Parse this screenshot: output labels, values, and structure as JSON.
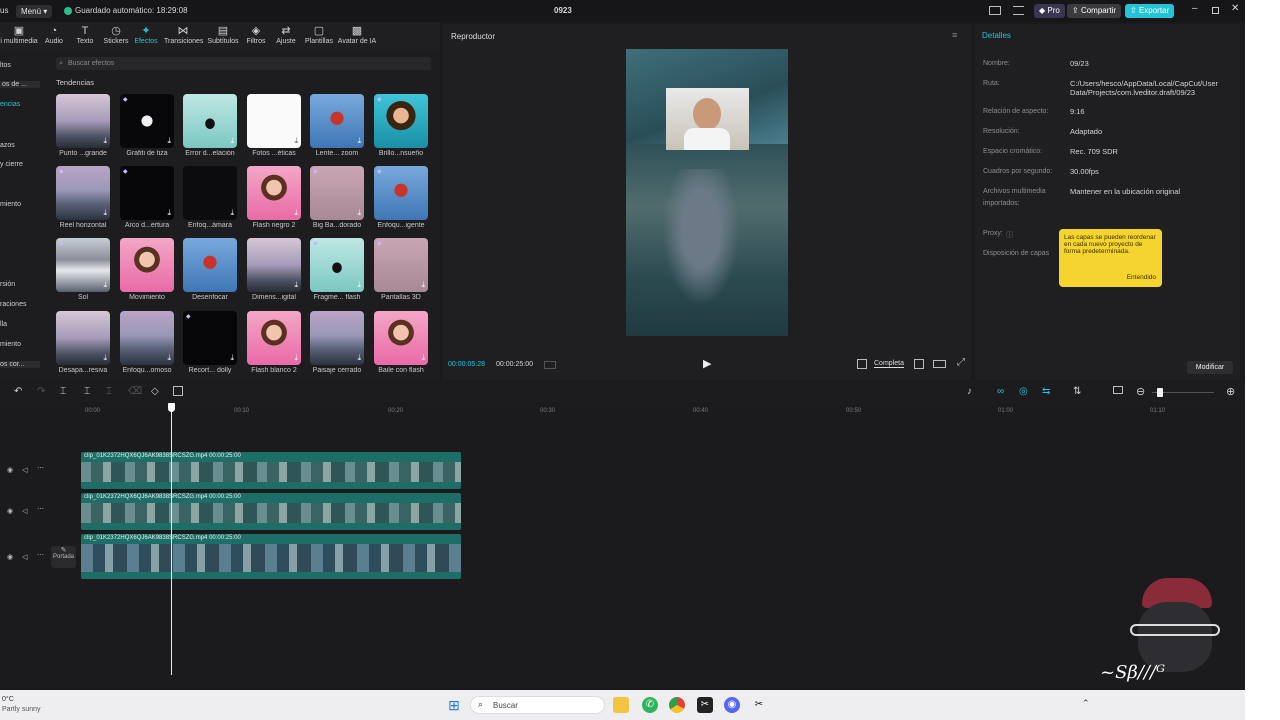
{
  "titlebar": {
    "left_fragment": "us",
    "menu_label": "Menú",
    "autosave": "Guardado automático: 18:29:08",
    "project_name": "0923",
    "pro_label": "Pro",
    "share_label": "Compartir",
    "export_label": "Exportar",
    "accent": "#23c4d8"
  },
  "toolbar": {
    "items": [
      "multimedia",
      "Audio",
      "Texto",
      "Stickers",
      "Efectos",
      "Transiciones",
      "Subtítulos",
      "Filtros",
      "Ajuste",
      "Plantillas",
      "Avatar de IA"
    ],
    "first_label": "i multimedia",
    "active": "Efectos"
  },
  "sidebar": {
    "items": [
      "ltos",
      "os de ...",
      "encias",
      "azos",
      "y cierre",
      "miento",
      "rsión",
      "raciones",
      "lla",
      "miento",
      "os cor..."
    ]
  },
  "effects": {
    "search_placeholder": "Buscar efectos",
    "section_title": "Tendencias",
    "tiles": [
      "Punto ...grande",
      "Grafiti de tiza",
      "Error d...elación",
      "Fotos ...éticas",
      "Lente... zoom",
      "Brillo...nsueño",
      "Reel horizontal",
      "Arco d...ertura",
      "Enfoq...ámara",
      "Flash negro 2",
      "Big Ba...dorado",
      "Enfoqu...igente",
      "Sol",
      "Movimiento",
      "Desenfocar",
      "Dimens...igital",
      "Fragme... flash",
      "Pantallas 3D",
      "Desapa...resiva",
      "Enfoqu...omoso",
      "Recort... dolly",
      "Flash blanco 2",
      "Paisaje cerrado",
      "Baile con flash"
    ]
  },
  "player": {
    "title": "Reproductor",
    "current_time": "00:00:05:28",
    "total_time": "00:00:25:00",
    "ratio_label": "Completa"
  },
  "details": {
    "title": "Detalles",
    "labels": [
      "Nombre:",
      "Ruta:",
      "Relación de aspecto:",
      "Resolución:",
      "Espacio cromático:",
      "Cuadros por segundo:",
      "Archivos multimedia",
      "importados:",
      "Proxy:",
      "Disposición de capas"
    ],
    "values": {
      "name": "09/23",
      "path_1": "C:/Users/hesco/AppData/Local/CapCut/User",
      "path_2": "Data/Projects/com.lveditor.draft/09/23",
      "aspect": "9:16",
      "resolution": "Adaptado",
      "color_space": "Rec. 709 SDR",
      "fps": "30.00fps",
      "media": "Mantener en la ubicación original"
    },
    "tooltip_text": "Las capas se pueden reordenar en cada nuevo proyecto de forma predeterminada.",
    "tooltip_button": "Entendido",
    "modify_button": "Modificar"
  },
  "timeline": {
    "ticks": [
      "00:00",
      "00:10",
      "00:20",
      "00:30",
      "00:40",
      "00:50",
      "01:00",
      "01:10"
    ],
    "clip_name": "clip_01K2372HQX6QJ6AK9838SRCSZG.mp4",
    "clip_duration": "00:00:25:00",
    "cover_label": "Portada"
  },
  "taskbar": {
    "weather_temp": "0°C",
    "weather_desc": "Partly sunny",
    "search_label": "Buscar"
  }
}
